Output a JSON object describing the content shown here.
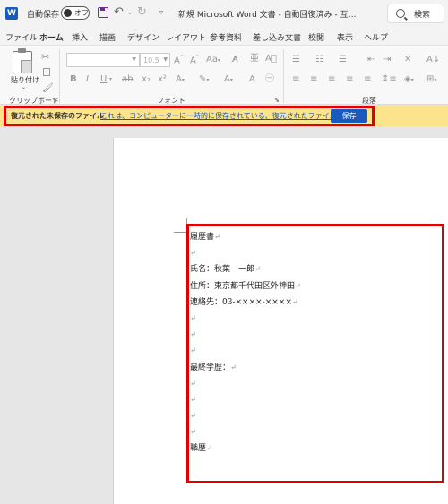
{
  "titlebar": {
    "app_icon": "W",
    "autosave_label": "自動保存",
    "autosave_state": "オフ",
    "doc_title": "新規 Microsoft Word 文書 - 自動回復済み - 互…",
    "search_label": "検索"
  },
  "tabs": [
    "ファイル",
    "ホーム",
    "挿入",
    "描画",
    "デザイン",
    "レイアウト",
    "参考資料",
    "差し込み文書",
    "校閲",
    "表示",
    "ヘルプ"
  ],
  "active_tab": "ホーム",
  "ribbon": {
    "paste_label": "貼り付け",
    "clipboard_group": "クリップボード",
    "font_group": "フォント",
    "paragraph_group": "段落",
    "font_size": "10.5"
  },
  "infobar": {
    "title": "復元された未保存のファイル",
    "message": "これは、コンピューターに一時的に保存されている、復元されたファイルです。",
    "button": "保存"
  },
  "document": {
    "lines": [
      "履歴書",
      "",
      "氏名：秋葉　一郎",
      "住所：東京都千代田区外神田",
      "連絡先：03-××××-××××",
      "",
      "",
      "",
      "最終学歴：",
      "",
      "",
      "",
      "",
      "職歴"
    ],
    "paragraph_mark": "↵"
  },
  "colors": {
    "accent": "#185abd",
    "infobar": "#fce48d",
    "highlight": "#e00000"
  }
}
